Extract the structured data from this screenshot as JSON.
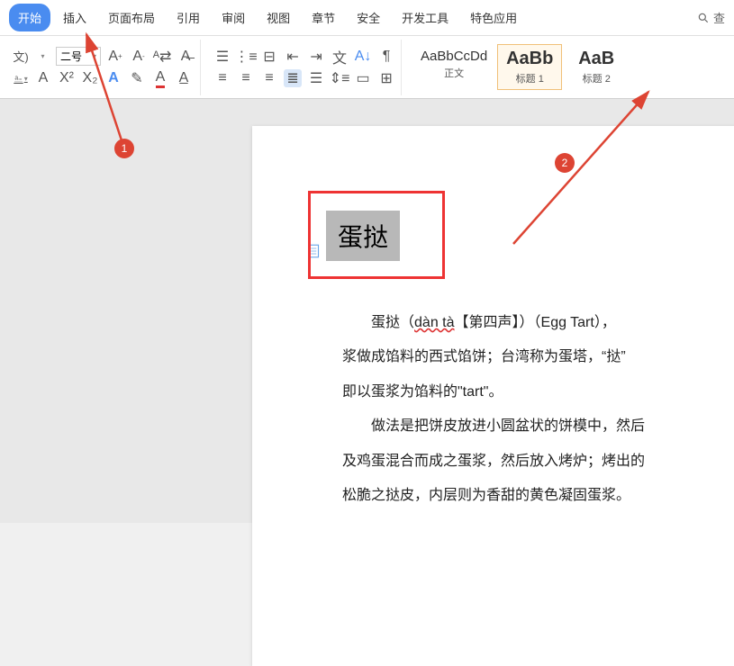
{
  "menu": {
    "items": [
      "开始",
      "插入",
      "页面布局",
      "引用",
      "审阅",
      "视图",
      "章节",
      "安全",
      "开发工具",
      "特色应用"
    ],
    "search": "查"
  },
  "ribbon": {
    "font_left_label": "文)",
    "font_size": "二号",
    "styles": [
      {
        "preview": "AaBbCcDd",
        "name": "正文"
      },
      {
        "preview": "AaBb",
        "name": "标题 1"
      },
      {
        "preview": "AaB",
        "name": "标题 2"
      }
    ]
  },
  "doc": {
    "title": "蛋挞",
    "p1a": "蛋挞（",
    "p1b": "dàn tà",
    "p1c": "【第四声】",
    "p1d": "）（Egg Tart），",
    "p2": "浆做成馅料的西式馅饼；台湾称为蛋塔，“挞”",
    "p3": "即以蛋浆为馅料的\"tart\"。",
    "p4": "做法是把饼皮放进小圆盆状的饼模中，然后",
    "p5": "及鸡蛋混合而成之蛋浆，然后放入烤炉；烤出的",
    "p6": "松脆之挞皮，内层则为香甜的黄色凝固蛋浆。"
  },
  "markers": {
    "m1": "1",
    "m2": "2"
  }
}
